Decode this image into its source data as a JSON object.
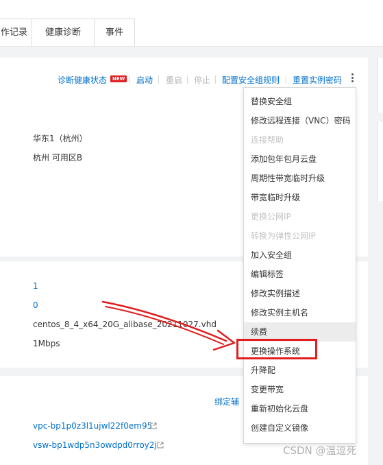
{
  "tabs": [
    "作记录",
    "健康诊断",
    "事件"
  ],
  "actions": {
    "diagnose": "诊断健康状态",
    "new_badge": "NEW",
    "start": "启动",
    "restart": "重启",
    "stop": "停止",
    "security_rules": "配置安全组规则",
    "reset_password": "重置实例密码"
  },
  "info": {
    "region": "华东1（杭州）",
    "zone": "杭州 可用区B",
    "val1": "1",
    "val2": "0",
    "image": "centos_8_4_x64_20G_alibase_20211027.vhd",
    "bandwidth": "1Mbps"
  },
  "network": {
    "bind_label": "绑定辅",
    "vpc": "vpc-bp1p0z3l1ujwl22f0em95",
    "vsw": "vsw-bp1wdp5n3owdpd0rroy2j"
  },
  "menu_items": [
    {
      "label": "替换安全组",
      "disabled": false
    },
    {
      "label": "修改远程连接（VNC）密码",
      "disabled": false
    },
    {
      "label": "连接帮助",
      "disabled": true
    },
    {
      "label": "添加包年包月云盘",
      "disabled": false
    },
    {
      "label": "周期性带宽临时升级",
      "disabled": false
    },
    {
      "label": "带宽临时升级",
      "disabled": false
    },
    {
      "label": "更换公网IP",
      "disabled": true
    },
    {
      "label": "转换为弹性公网IP",
      "disabled": true
    },
    {
      "label": "加入安全组",
      "disabled": false
    },
    {
      "label": "编辑标签",
      "disabled": false
    },
    {
      "label": "修改实例描述",
      "disabled": false
    },
    {
      "label": "修改实例主机名",
      "disabled": false
    },
    {
      "label": "续费",
      "disabled": false,
      "hover": true
    },
    {
      "label": "更换操作系统",
      "disabled": false,
      "highlighted": true
    },
    {
      "label": "升降配",
      "disabled": false
    },
    {
      "label": "变更带宽",
      "disabled": false
    },
    {
      "label": "重新初始化云盘",
      "disabled": false
    },
    {
      "label": "创建自定义镜像",
      "disabled": false
    }
  ],
  "watermark": "CSDN @温逗死",
  "colors": {
    "link": "#0070cc",
    "annotation": "#e11d1d",
    "disabled": "#c2c2c2"
  }
}
